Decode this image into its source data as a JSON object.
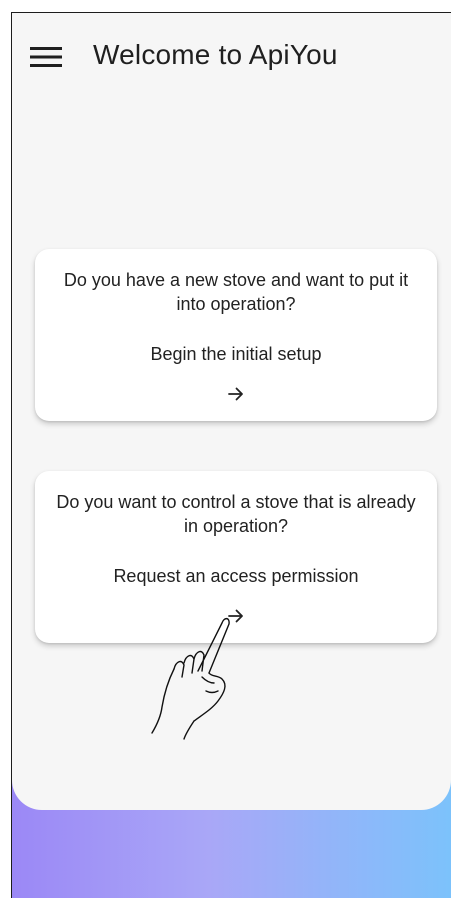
{
  "app": {
    "title": "Welcome to ApiYou"
  },
  "appbar": {
    "menu_icon": "hamburger-menu-icon"
  },
  "cards": [
    {
      "question": "Do you have a new stove and want to put it into operation?",
      "action": "Begin the initial setup",
      "icon": "arrow-right-icon"
    },
    {
      "question": "Do you want to control a stove that is already in operation?",
      "action": "Request an access permission",
      "icon": "arrow-right-icon"
    }
  ],
  "overlay": {
    "icon": "hand-pointer-icon"
  },
  "colors": {
    "background": "#f6f6f6",
    "card": "#ffffff",
    "text": "#222222",
    "gradient_start": "#9b88f6",
    "gradient_end": "#7cc2fb"
  }
}
